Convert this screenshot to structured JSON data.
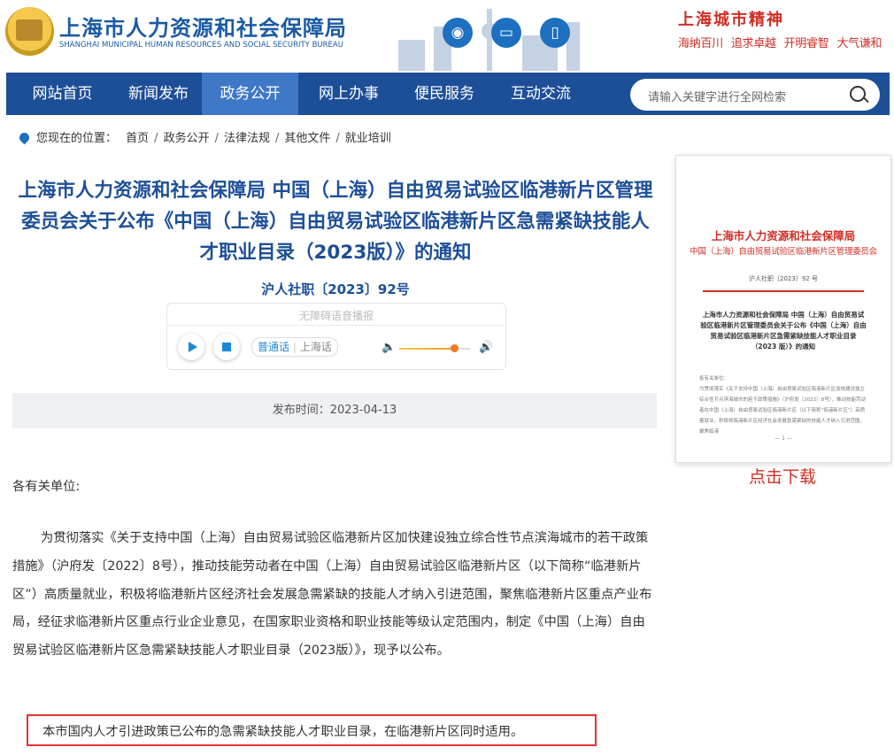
{
  "header": {
    "title": "上海市人力资源和社会保障局",
    "subtitle": "SHANGHAI MUNICIPAL HUMAN RESOURCES AND SOCIAL SECURITY BUREAU",
    "icons": [
      "weibo-icon",
      "desktop-icon",
      "mobile-icon"
    ],
    "spirit_title": "上海城市精神",
    "spirit_words": [
      "海纳百川",
      "追求卓越",
      "开明睿智",
      "大气谦和"
    ]
  },
  "nav": {
    "items": [
      "网站首页",
      "新闻发布",
      "政务公开",
      "网上办事",
      "便民服务",
      "互动交流"
    ],
    "active": "政务公开",
    "search_placeholder": "请输入关键字进行全网检索"
  },
  "breadcrumb": {
    "label": "您现在的位置：",
    "items": [
      "首页",
      "政务公开",
      "法律法规",
      "其他文件",
      "就业培训"
    ]
  },
  "article": {
    "title": "上海市人力资源和社会保障局 中国（上海）自由贸易试验区临港新片区管理委员会关于公布《中国（上海）自由贸易试验区临港新片区急需紧缺技能人才职业目录（2023版）》的通知",
    "doc_no": "沪人社职〔2023〕92号",
    "player": {
      "caption": "无障碍语音播报",
      "lang_on": "普通话",
      "lang_off": "上海话",
      "volume": 0.78
    },
    "publish": "发布时间：2023-04-13",
    "greeting": "各有关单位:",
    "paragraph": "为贯彻落实《关于支持中国（上海）自由贸易试验区临港新片区加快建设独立综合性节点滨海城市的若干政策措施》（沪府发〔2022〕8号），推动技能劳动者在中国（上海）自由贸易试验区临港新片区（以下简称“临港新片区”）高质量就业，积极将临港新片区经济社会发展急需紧缺的技能人才纳入引进范围，聚焦临港新片区重点产业布局，经征求临港新片区重点行业企业意见，在国家职业资格和职业技能等级认定范围内，制定《中国（上海）自由贸易试验区临港新片区急需紧缺技能人才职业目录（2023版）》，现予以公布。",
    "notice": "本市国内人才引进政策已公布的急需紧缺技能人才职业目录，在临港新片区同时适用。"
  },
  "sidebar": {
    "thumb_org1": "上海市人力资源和社会保障局",
    "thumb_org2": "中国（上海）自由贸易试验区临港新片区管理委员会",
    "thumb_no": "沪人社职〔2023〕92 号",
    "thumb_title": "上海市人力资源和社会保障局 中国（上海）自由贸易试验区临港新片区管理委员会关于公布《中国（上海）自由贸易试验区临港新片区急需紧缺技能人才职业目录（2023 版）》的通知",
    "thumb_greet": "各有关单位：",
    "thumb_body": "为贯彻落实《关于支持中国（上海）自由贸易试验区临港新片区加快建设独立综合性节点滨海城市的若干政策措施》（沪府发〔2022〕8号），推动技能劳动者在中国（上海）自由贸易试验区临港新片区（以下简称“临港新片区”）高质量就业，积极将临港新片区经济社会发展急需紧缺的技能人才纳入引进范围，聚焦临港",
    "thumb_page": "— 1 —",
    "download": "点击下载"
  },
  "colors": {
    "brand": "#1d4f98",
    "nav_active": "#3f78c6",
    "accent_red": "#d02d24",
    "notice_border": "#e53232"
  }
}
